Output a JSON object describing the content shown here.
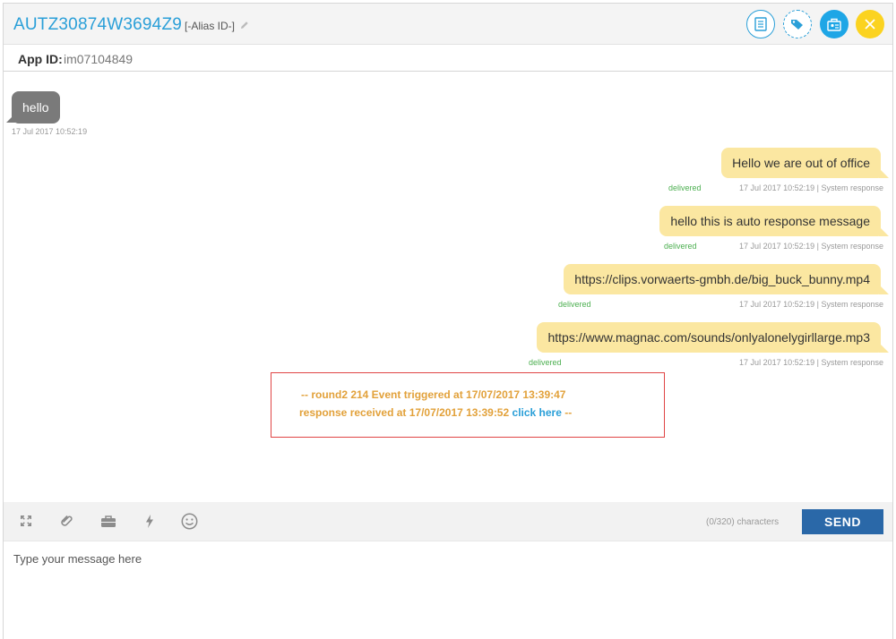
{
  "header": {
    "contact_id": "AUTZ30874W3694Z9",
    "alias_label": "[-Alias ID-]",
    "icons": [
      "notes-icon",
      "tags-icon",
      "contact-card-icon",
      "close-icon"
    ],
    "colors": {
      "accent": "#2a9fd8",
      "close": "#fbd320"
    }
  },
  "app": {
    "label": "App ID:",
    "value": "im07104849"
  },
  "messages": {
    "incoming": {
      "text": "hello",
      "time": "17 Jul 2017 10:52:19"
    },
    "outgoing": [
      {
        "text": "Hello we are out of office",
        "status": "delivered",
        "meta": "17 Jul 2017 10:52:19 | System response"
      },
      {
        "text": "hello this is auto response message",
        "status": "delivered",
        "meta": "17 Jul 2017 10:52:19 | System response"
      },
      {
        "text": "https://clips.vorwaerts-gmbh.de/big_buck_bunny.mp4",
        "status": "delivered",
        "meta": "17 Jul 2017 10:52:19 | System response"
      },
      {
        "text": "https://www.magnac.com/sounds/onlyalonelygirllarge.mp3",
        "status": "delivered",
        "meta": "17 Jul 2017 10:52:19 | System response"
      }
    ]
  },
  "event": {
    "line1": "-- round2 214 Event triggered at 17/07/2017 13:39:47",
    "line2": "response received at 17/07/2017 13:39:52",
    "link": "click here",
    "line2_end": "--"
  },
  "toolbar": {
    "icons": [
      "expand-icon",
      "attachment-icon",
      "briefcase-icon",
      "flash-icon",
      "emoji-icon"
    ],
    "char_count": "(0/320) characters",
    "send_label": "SEND"
  },
  "composer": {
    "placeholder": "Type your message here"
  }
}
